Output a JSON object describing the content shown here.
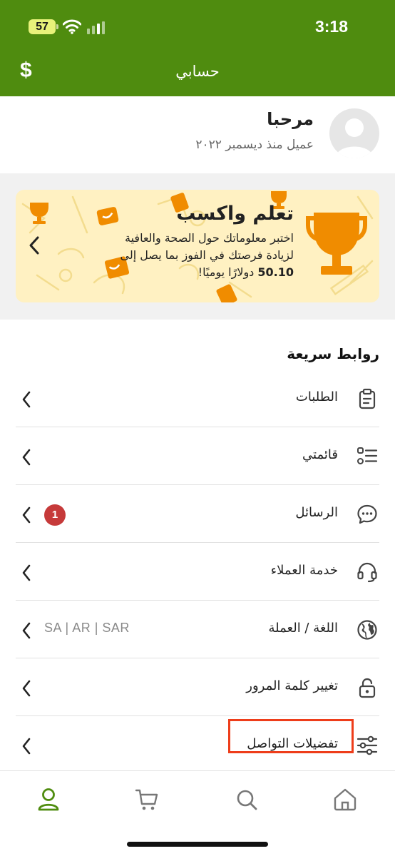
{
  "status_bar": {
    "battery": "57",
    "time": "3:18"
  },
  "header": {
    "title": "حسابي",
    "left_icon": "dollar-sign-icon",
    "left_symbol": "$"
  },
  "profile": {
    "greeting": "مرحبا",
    "member_since": "عميل منذ ديسمبر ٢٠٢٢",
    "avatar_icon": "user-avatar-icon"
  },
  "banner": {
    "title": "تعلم واكسب",
    "text_line1": "اختبر معلوماتك حول الصحة والعافية",
    "text_line2": "لزيادة فرصتك في الفوز بما يصل إلى",
    "amount": "50.10",
    "text_line3_rest": "دولارًا يوميًا!",
    "icon": "trophy-icon"
  },
  "quick_links": {
    "title": "روابط سريعة",
    "items": [
      {
        "label": "الطلبات",
        "icon": "clipboard-icon"
      },
      {
        "label": "قائمتي",
        "icon": "list-icon"
      },
      {
        "label": "الرسائل",
        "icon": "chat-bubble-icon",
        "badge": "1"
      },
      {
        "label": "خدمة العملاء",
        "icon": "headset-icon"
      },
      {
        "label": "اللغة / العملة",
        "icon": "globe-icon",
        "value": "SA | AR | SAR"
      },
      {
        "label": "تغيير كلمة المرور",
        "icon": "lock-icon"
      },
      {
        "label": "تفضيلات التواصل",
        "icon": "sliders-icon",
        "highlighted": true
      }
    ]
  },
  "tab_bar": {
    "tabs": [
      {
        "name": "account",
        "icon": "user-icon",
        "active": true
      },
      {
        "name": "cart",
        "icon": "cart-icon",
        "active": false
      },
      {
        "name": "search",
        "icon": "search-icon",
        "active": false
      },
      {
        "name": "home",
        "icon": "home-icon",
        "active": false
      }
    ]
  },
  "colors": {
    "brand_green": "#4f8c0f",
    "banner_bg": "#fff1c2",
    "accent_orange": "#f08c00",
    "badge_red": "#c63a3a",
    "highlight_red": "#ee3d1a"
  }
}
